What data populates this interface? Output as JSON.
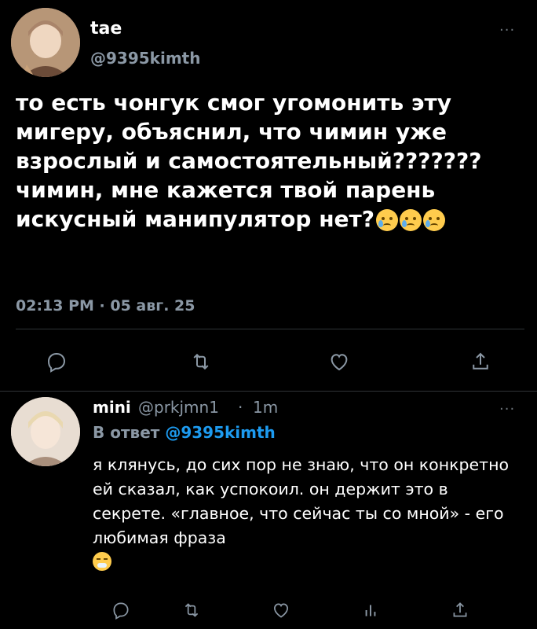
{
  "main_tweet": {
    "author_name": "tae",
    "author_handle": "@9395kimth",
    "more_label": "···",
    "text": "то есть чонгук смог угомонить эту мигеру, объяснил, что чимин уже взрослый и самостоятельный??????? чимин, мне кажется твой парень искусный манипулятор нет?",
    "text_emoji_count": 3,
    "timestamp": "02:13 PM · 05 авг. 25",
    "actions": [
      "reply-icon",
      "retweet-icon",
      "like-icon",
      "share-icon"
    ]
  },
  "reply_tweet": {
    "author_name": "mini",
    "author_handle": "@prkjmn1",
    "separator": "·",
    "time": "1m",
    "more_label": "···",
    "reply_to_label": "В ответ",
    "reply_to_handle": "@9395kimth",
    "text": "я клянусь, до сих пор не знаю, что он конкретно ей сказал, как успокоил. он держит это в секрете. «главное, что сейчас ты со мной» - его любимая фраза",
    "actions": [
      "reply-icon",
      "retweet-icon",
      "like-icon",
      "analytics-icon",
      "share-icon"
    ]
  },
  "colors": {
    "background": "#000000",
    "text_primary": "#ffffff",
    "text_secondary": "#8b98a5",
    "accent": "#1d9bf0",
    "divider": "#2f3336"
  }
}
